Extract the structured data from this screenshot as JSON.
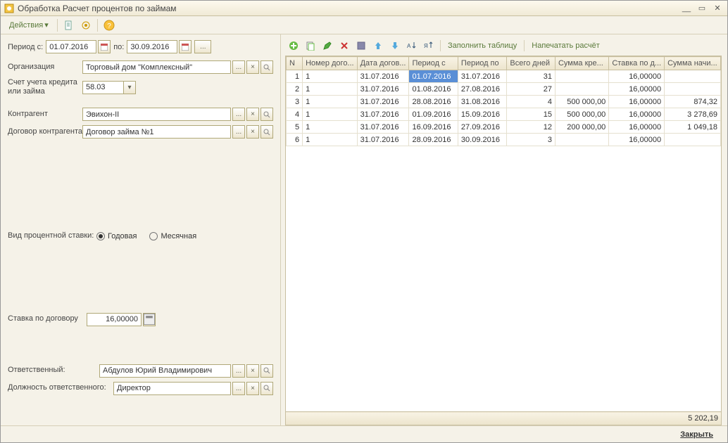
{
  "window": {
    "title": "Обработка  Расчет процентов по займам"
  },
  "toolbar": {
    "actions_label": "Действия"
  },
  "form": {
    "period_label": "Период с:",
    "period_to_label": "по:",
    "period_from": "01.07.2016",
    "period_to": "30.09.2016",
    "org_label": "Организация",
    "org_value": "Торговый дом \"Комплексный\"",
    "account_label": "Счет учета кредита или займа",
    "account_value": "58.03",
    "counterparty_label": "Контрагент",
    "counterparty_value": "Эвихон-II",
    "contract_label": "Договор контрагента",
    "contract_value": "Договор займа №1",
    "rate_type_label": "Вид процентной ставки:",
    "rate_yearly": "Годовая",
    "rate_monthly": "Месячная",
    "contract_rate_label": "Ставка по договору",
    "contract_rate_value": "16,00000",
    "responsible_label": "Ответственный:",
    "responsible_value": "Абдулов Юрий Владимирович",
    "position_label": "Должность ответственного:",
    "position_value": "Директор"
  },
  "grid": {
    "fill_label": "Заполнить таблицу",
    "print_label": "Напечатать расчёт",
    "columns": {
      "n": "N",
      "doc_num": "Номер дого...",
      "doc_date": "Дата догов...",
      "period_from": "Период с",
      "period_to": "Период по",
      "days": "Всего дней",
      "credit_sum": "Сумма кре...",
      "rate": "Ставка по д...",
      "accrued": "Сумма начи..."
    },
    "rows": [
      {
        "n": "1",
        "doc": "1",
        "date": "31.07.2016",
        "pf": "01.07.2016",
        "pt": "31.07.2016",
        "days": "31",
        "sum": "",
        "rate": "16,00000",
        "acc": "",
        "sel": true
      },
      {
        "n": "2",
        "doc": "1",
        "date": "31.07.2016",
        "pf": "01.08.2016",
        "pt": "27.08.2016",
        "days": "27",
        "sum": "",
        "rate": "16,00000",
        "acc": ""
      },
      {
        "n": "3",
        "doc": "1",
        "date": "31.07.2016",
        "pf": "28.08.2016",
        "pt": "31.08.2016",
        "days": "4",
        "sum": "500 000,00",
        "rate": "16,00000",
        "acc": "874,32"
      },
      {
        "n": "4",
        "doc": "1",
        "date": "31.07.2016",
        "pf": "01.09.2016",
        "pt": "15.09.2016",
        "days": "15",
        "sum": "500 000,00",
        "rate": "16,00000",
        "acc": "3 278,69"
      },
      {
        "n": "5",
        "doc": "1",
        "date": "31.07.2016",
        "pf": "16.09.2016",
        "pt": "27.09.2016",
        "days": "12",
        "sum": "200 000,00",
        "rate": "16,00000",
        "acc": "1 049,18"
      },
      {
        "n": "6",
        "doc": "1",
        "date": "31.07.2016",
        "pf": "28.09.2016",
        "pt": "30.09.2016",
        "days": "3",
        "sum": "",
        "rate": "16,00000",
        "acc": ""
      }
    ],
    "total": "5 202,19"
  },
  "footer": {
    "close": "Закрыть"
  }
}
